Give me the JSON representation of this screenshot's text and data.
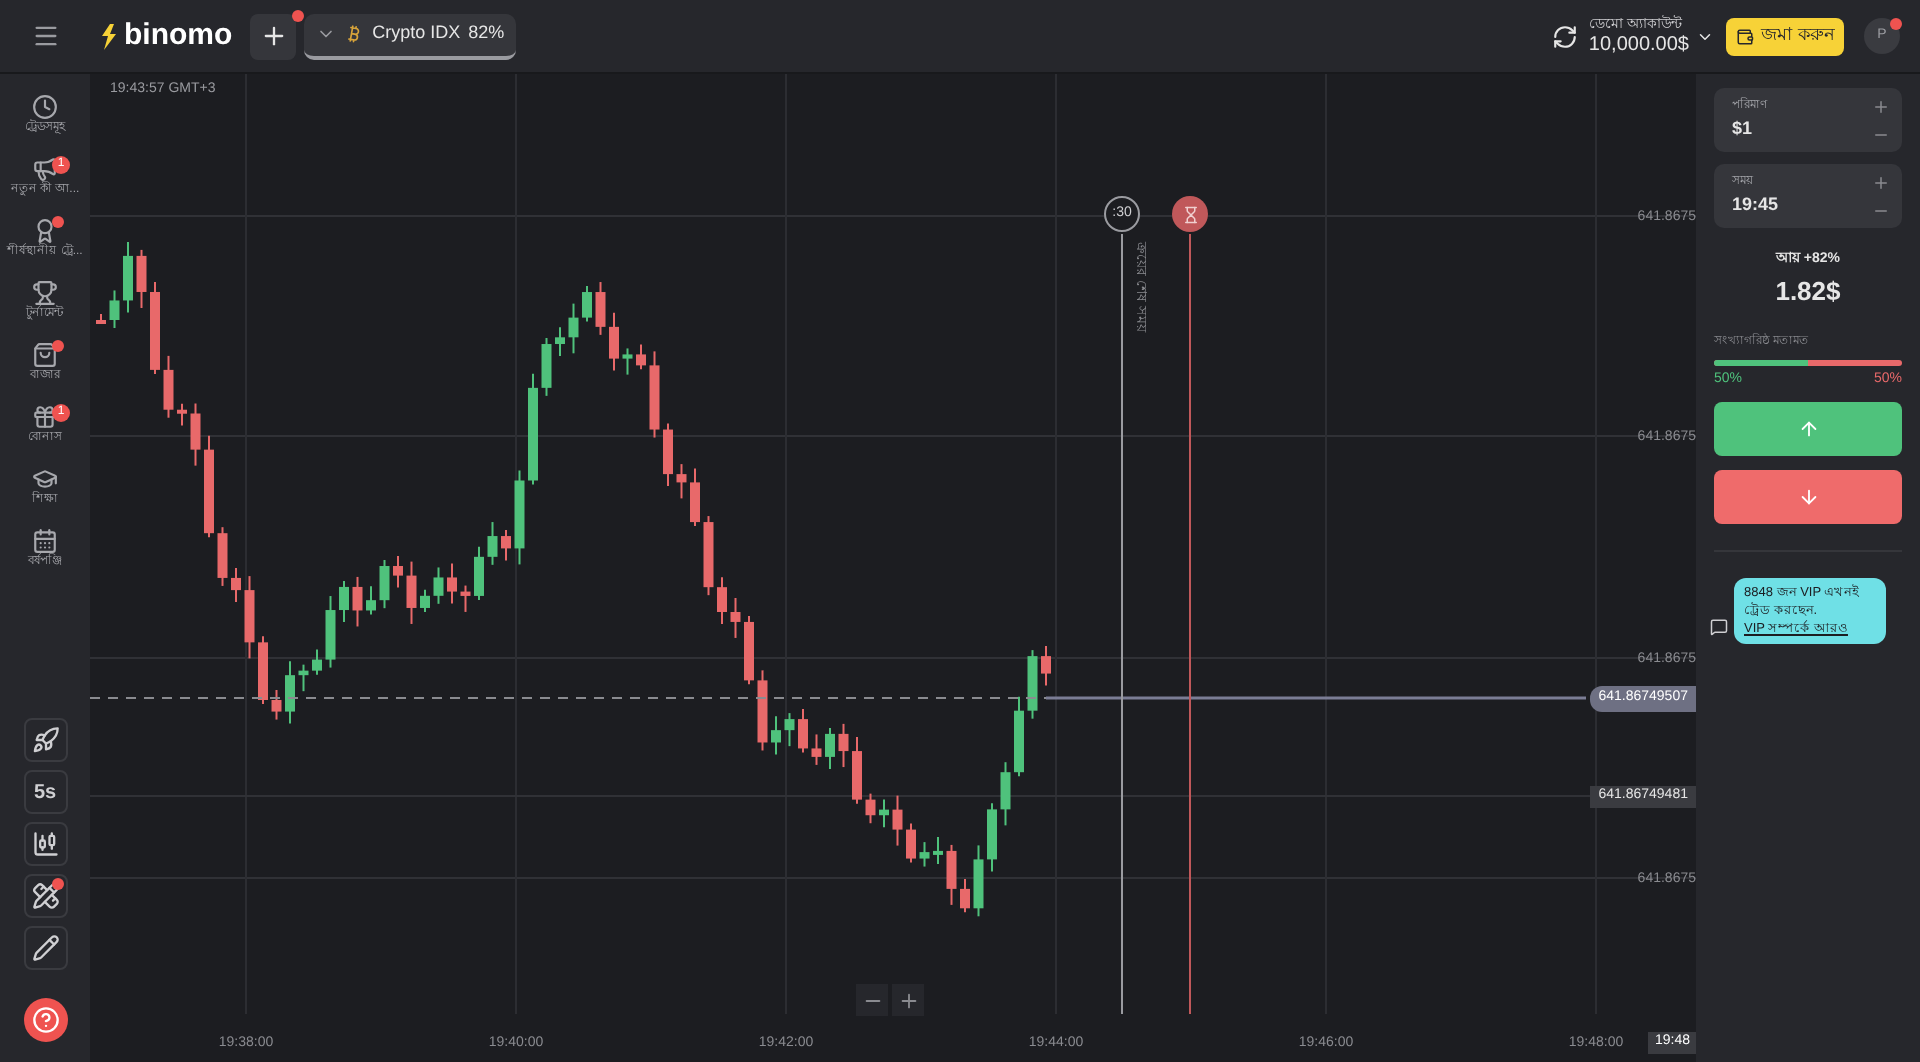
{
  "top_bar": {
    "logo": "binomo",
    "add_button": {
      "notification": true
    },
    "asset": {
      "name": "Crypto IDX",
      "payout": "82%"
    },
    "account": {
      "label": "ডেমো অ্যাকাউন্ট",
      "balance": "10,000.00$"
    },
    "deposit_button": "জমা করুন",
    "avatar": {
      "initial": "P",
      "notification": true
    }
  },
  "sidebar": {
    "items": [
      {
        "label": "ট্রেডসমূহ",
        "notification": false
      },
      {
        "label": "নতুন কী আ...",
        "badge": "1",
        "notification": false
      },
      {
        "label": "শীর্ষস্থানীয় ট্রে...",
        "notification": true
      },
      {
        "label": "টুর্নামেন্ট",
        "notification": false
      },
      {
        "label": "বাজার",
        "notification": true
      },
      {
        "label": "বোনাস",
        "badge": "1",
        "notification": false
      },
      {
        "label": "শিক্ষা",
        "notification": false
      },
      {
        "label": "বর্ষপঞ্জি",
        "notification": false
      }
    ],
    "tools": [
      {
        "kind": "rocket"
      },
      {
        "kind": "text",
        "label": "5s"
      },
      {
        "kind": "indicators"
      },
      {
        "kind": "drawing",
        "notification": true
      },
      {
        "kind": "pencil"
      }
    ]
  },
  "chart": {
    "clock": "19:43:57 GMT+3",
    "price_labels": [
      "641.8675",
      "641.8675",
      "641.8675",
      "641.8675"
    ],
    "current_price": "641.86749507",
    "line_price": "641.86749481",
    "timer": ":30",
    "deadline_label": "ক্রয়ের শেষ সময়",
    "time_labels": [
      "19:38:00",
      "19:40:00",
      "19:42:00",
      "19:44:00",
      "19:46:00",
      "19:48:00"
    ],
    "time_badge": "19:48"
  },
  "trade_panel": {
    "amount": {
      "label": "পরিমাণ",
      "value": "$1"
    },
    "time": {
      "label": "সময়",
      "value": "19:45"
    },
    "income_label": "আয় +82%",
    "income": "1.82$",
    "sentiment": {
      "label": "সংখ্যাগরিষ্ঠ মতামত",
      "level": 0.5,
      "up": "50%",
      "down": "50%"
    }
  },
  "chat": {
    "text": "8848 জন VIP এখনই ট্রেড করছেন.",
    "link": "VIP সম্পর্কে আরও"
  }
}
